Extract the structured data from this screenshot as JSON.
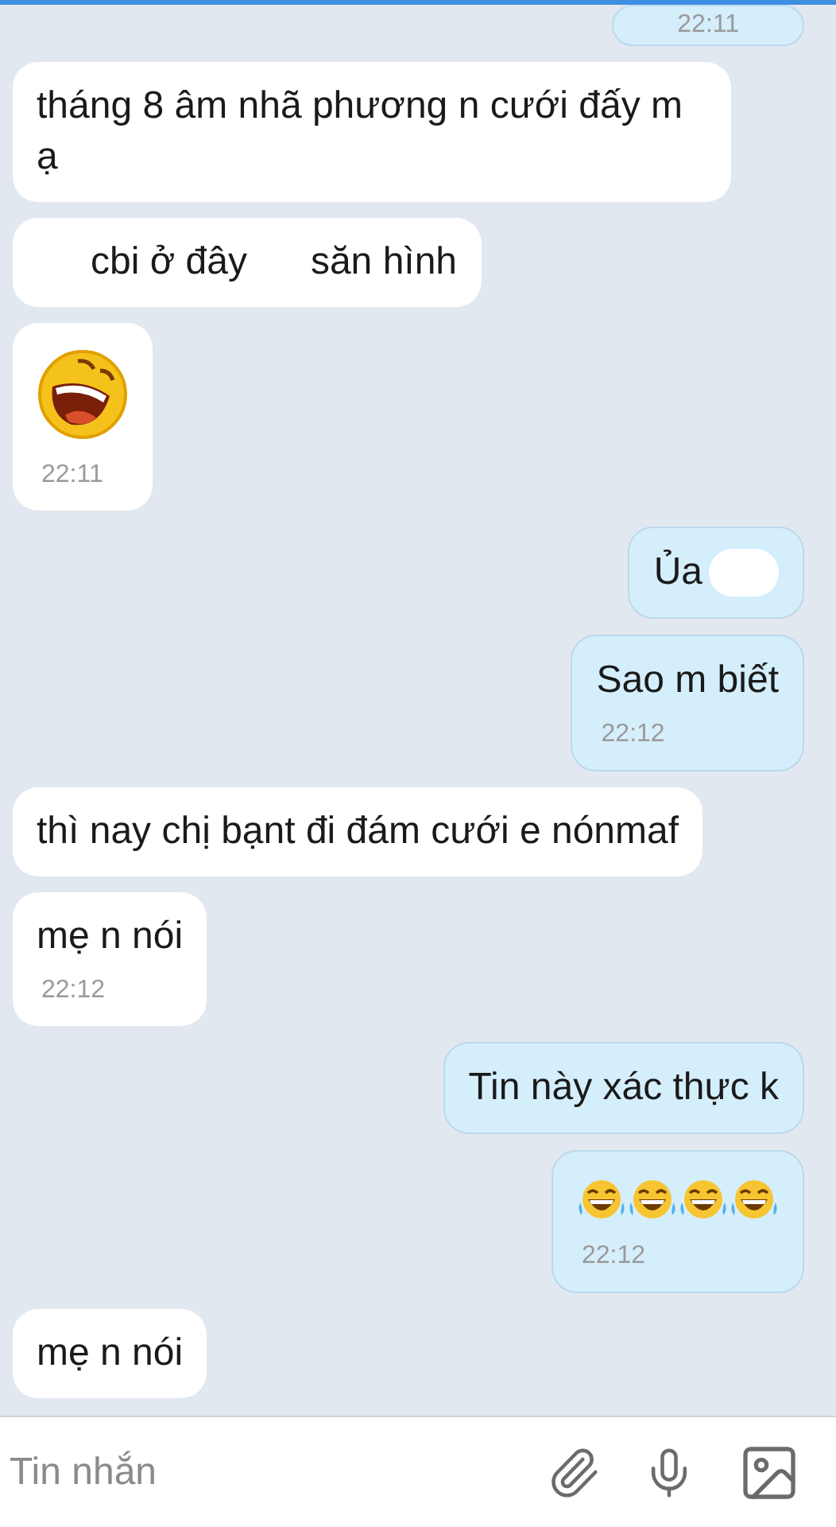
{
  "messages": [
    {
      "outgoing": true,
      "kind": "text",
      "time": "22:11"
    },
    {
      "outgoing": false,
      "kind": "text",
      "parts": [
        {
          "kind": "text",
          "text": "tháng 8 âm nhã phương n cưới đấy m ạ"
        }
      ]
    },
    {
      "outgoing": false,
      "kind": "text",
      "parts": [
        {
          "kind": "text",
          "text": "cbi ở đây"
        },
        {
          "kind": "text",
          "text": "săn hình"
        }
      ]
    },
    {
      "outgoing": false,
      "kind": "emoji",
      "emojis": [
        {
          "kind": "laughing"
        }
      ],
      "time": "22:11"
    },
    {
      "outgoing": true,
      "kind": "text",
      "parts": [
        {
          "kind": "text",
          "text": "Ủa"
        },
        {
          "kind": "blot"
        }
      ]
    },
    {
      "outgoing": true,
      "kind": "text",
      "parts": [
        {
          "kind": "text",
          "text": "Sao m biết"
        }
      ],
      "time": "22:12"
    },
    {
      "outgoing": false,
      "kind": "text",
      "parts": [
        {
          "kind": "text",
          "text": "thì nay chị bạnt  đi đám cưới e nónmaf"
        }
      ]
    },
    {
      "outgoing": false,
      "kind": "text",
      "parts": [
        {
          "kind": "text",
          "text": "mẹ n nói"
        }
      ],
      "time": "22:12"
    },
    {
      "outgoing": true,
      "kind": "text",
      "parts": [
        {
          "kind": "text",
          "text": "Tin này xác thực k"
        }
      ]
    },
    {
      "outgoing": true,
      "kind": "emoji",
      "emojis": [
        {
          "kind": "tears_of_joy"
        },
        {
          "kind": "tears_of_joy"
        },
        {
          "kind": "tears_of_joy"
        },
        {
          "kind": "tears_of_joy"
        }
      ],
      "time": "22:12"
    },
    {
      "outgoing": false,
      "kind": "text",
      "parts": [
        {
          "kind": "text",
          "text": "mẹ n nói"
        }
      ]
    }
  ],
  "composer": {
    "placeholder": "Tin nhắn"
  }
}
